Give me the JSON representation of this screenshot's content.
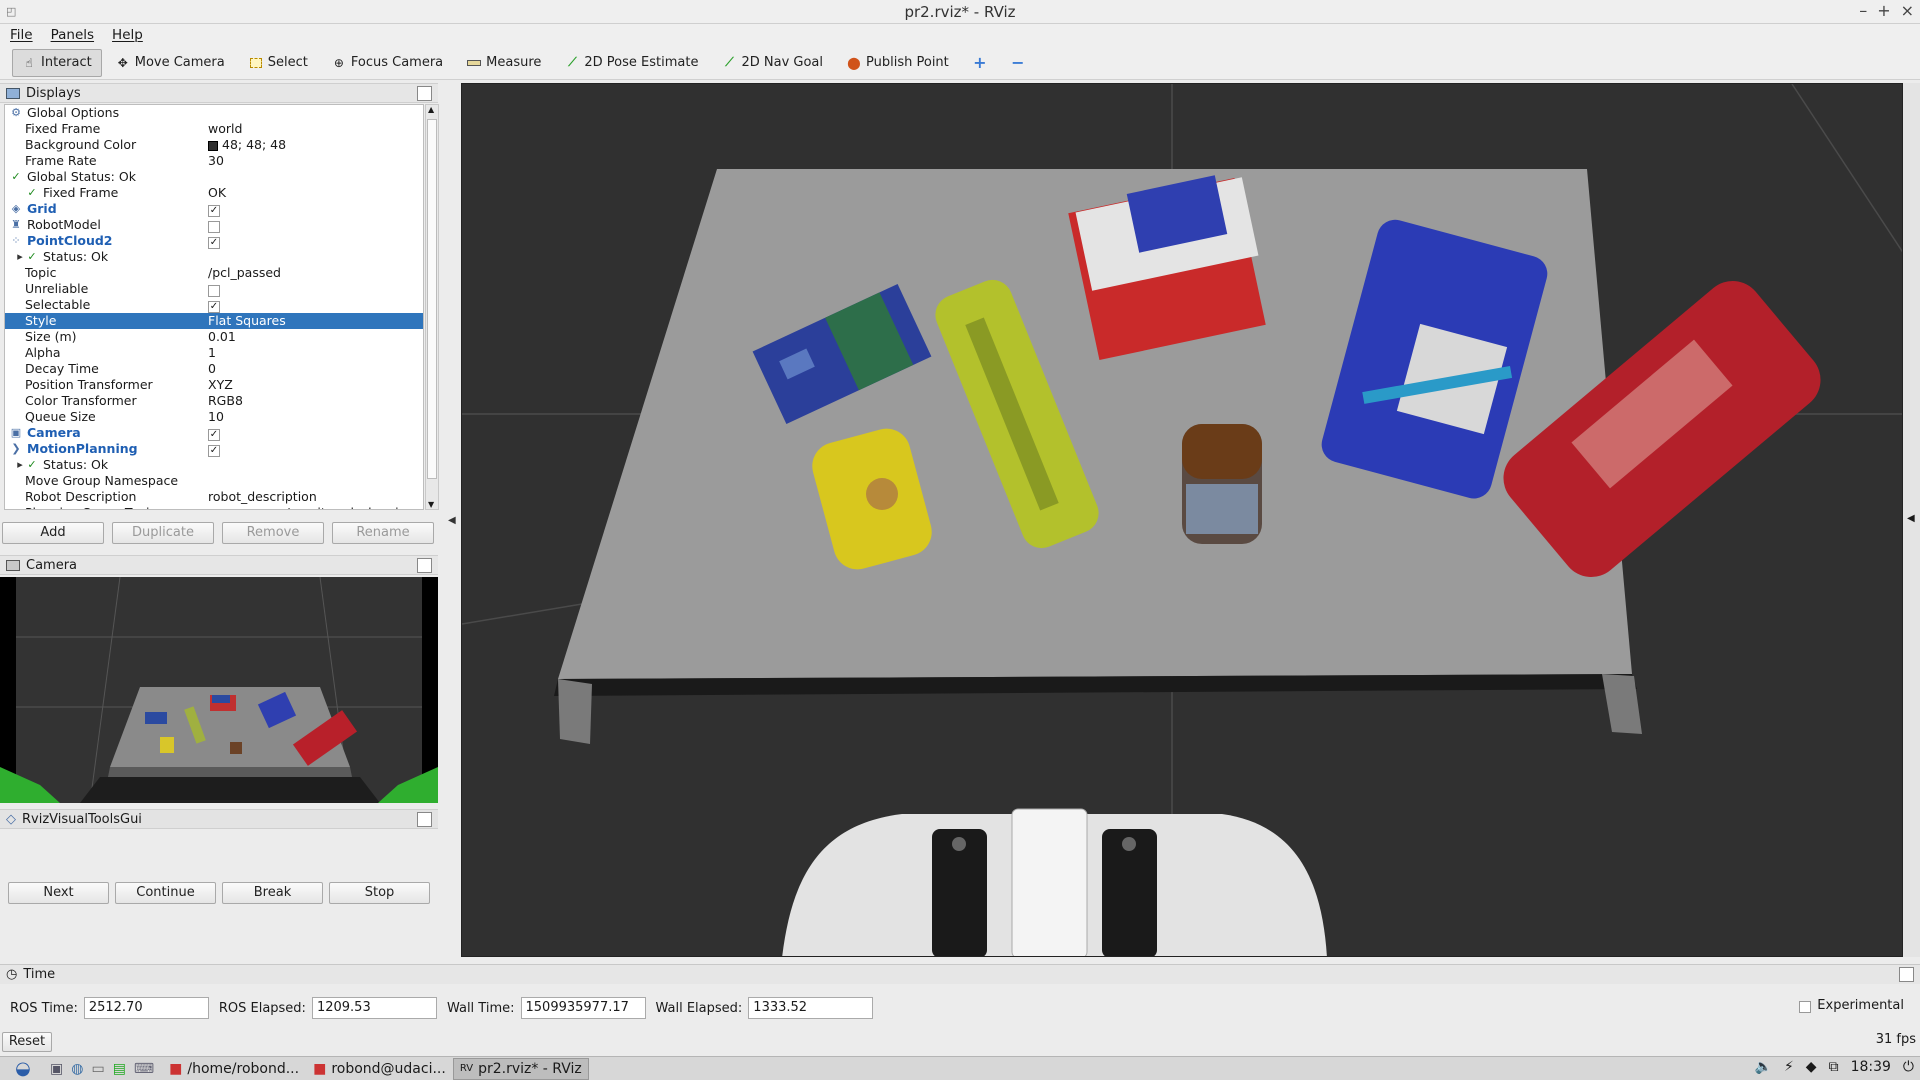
{
  "window": {
    "title": "pr2.rviz* - RViz",
    "controls": [
      "–",
      "+",
      "×"
    ]
  },
  "menu": [
    "File",
    "Panels",
    "Help"
  ],
  "toolbar": [
    {
      "label": "Interact",
      "icon": "interact-icon",
      "active": true
    },
    {
      "label": "Move Camera",
      "icon": "move-camera-icon"
    },
    {
      "label": "Select",
      "icon": "select-icon"
    },
    {
      "label": "Focus Camera",
      "icon": "focus-camera-icon"
    },
    {
      "label": "Measure",
      "icon": "ruler-icon"
    },
    {
      "label": "2D Pose Estimate",
      "icon": "green-arrow-icon"
    },
    {
      "label": "2D Nav Goal",
      "icon": "green-arrow-icon"
    },
    {
      "label": "Publish Point",
      "icon": "map-pin-icon"
    },
    {
      "label": "",
      "icon": "plus-icon"
    },
    {
      "label": "",
      "icon": "minus-icon"
    }
  ],
  "displays": {
    "title": "Displays",
    "rows": [
      {
        "label": "Global Options",
        "value": "",
        "indent": 0,
        "icon": "gear-icon"
      },
      {
        "label": "Fixed Frame",
        "value": "world",
        "indent": 1
      },
      {
        "label": "Background Color",
        "value": "48; 48; 48",
        "indent": 1,
        "swatch": "#303030"
      },
      {
        "label": "Frame Rate",
        "value": "30",
        "indent": 1
      },
      {
        "label": "Global Status: Ok",
        "value": "",
        "indent": 0,
        "icon": "check-icon"
      },
      {
        "label": "Fixed Frame",
        "value": "OK",
        "indent": 1,
        "icon": "check-icon"
      },
      {
        "label": "Grid",
        "value": "✓",
        "indent": 0,
        "icon": "grid-icon",
        "bold": true,
        "cb": true
      },
      {
        "label": "RobotModel",
        "value": "",
        "indent": 0,
        "icon": "robot-icon",
        "cb": true
      },
      {
        "label": "PointCloud2",
        "value": "✓",
        "indent": 0,
        "icon": "pointcloud-icon",
        "bold": true,
        "cb": true
      },
      {
        "label": "Status: Ok",
        "value": "",
        "indent": 1,
        "icon": "check-icon",
        "arrow": true
      },
      {
        "label": "Topic",
        "value": "/pcl_passed",
        "indent": 1
      },
      {
        "label": "Unreliable",
        "value": "",
        "indent": 1,
        "cb": true
      },
      {
        "label": "Selectable",
        "value": "✓",
        "indent": 1,
        "cb": true
      },
      {
        "label": "Style",
        "value": "Flat Squares",
        "indent": 1,
        "selected": true
      },
      {
        "label": "Size (m)",
        "value": "0.01",
        "indent": 1
      },
      {
        "label": "Alpha",
        "value": "1",
        "indent": 1
      },
      {
        "label": "Decay Time",
        "value": "0",
        "indent": 1
      },
      {
        "label": "Position Transformer",
        "value": "XYZ",
        "indent": 1
      },
      {
        "label": "Color Transformer",
        "value": "RGB8",
        "indent": 1
      },
      {
        "label": "Queue Size",
        "value": "10",
        "indent": 1
      },
      {
        "label": "Camera",
        "value": "✓",
        "indent": 0,
        "icon": "camera-icon",
        "bold": true,
        "cb": true
      },
      {
        "label": "MotionPlanning",
        "value": "✓",
        "indent": 0,
        "icon": "motion-planning-icon",
        "bold": true,
        "cb": true
      },
      {
        "label": "Status: Ok",
        "value": "",
        "indent": 1,
        "icon": "check-icon",
        "arrow": true
      },
      {
        "label": "Move Group Namespace",
        "value": "",
        "indent": 1
      },
      {
        "label": "Robot Description",
        "value": "robot_description",
        "indent": 1
      },
      {
        "label": "Planning Scene Topic",
        "value": "move_group/monitored_planning",
        "indent": 1
      }
    ],
    "buttons": [
      "Add",
      "Duplicate",
      "Remove",
      "Rename"
    ]
  },
  "camera_panel": {
    "title": "Camera"
  },
  "visual_tools": {
    "title": "RvizVisualToolsGui",
    "buttons": [
      "Next",
      "Continue",
      "Break",
      "Stop"
    ]
  },
  "time": {
    "title": "Time",
    "ros_time_label": "ROS Time:",
    "ros_time": "2512.70",
    "ros_elapsed_label": "ROS Elapsed:",
    "ros_elapsed": "1209.53",
    "wall_time_label": "Wall Time:",
    "wall_time": "1509935977.17",
    "wall_elapsed_label": "Wall Elapsed:",
    "wall_elapsed": "1333.52",
    "experimental_label": "Experimental",
    "reset_label": "Reset",
    "fps": "31 fps"
  },
  "taskbar": {
    "items": [
      "/home/robond...",
      "robond@udaci...",
      "pr2.rviz* - RViz"
    ],
    "clock": "18:39"
  },
  "colors": {
    "viewport_bg": "#303030",
    "selection": "#2f75bc",
    "bold_label": "#1f5fb3"
  }
}
